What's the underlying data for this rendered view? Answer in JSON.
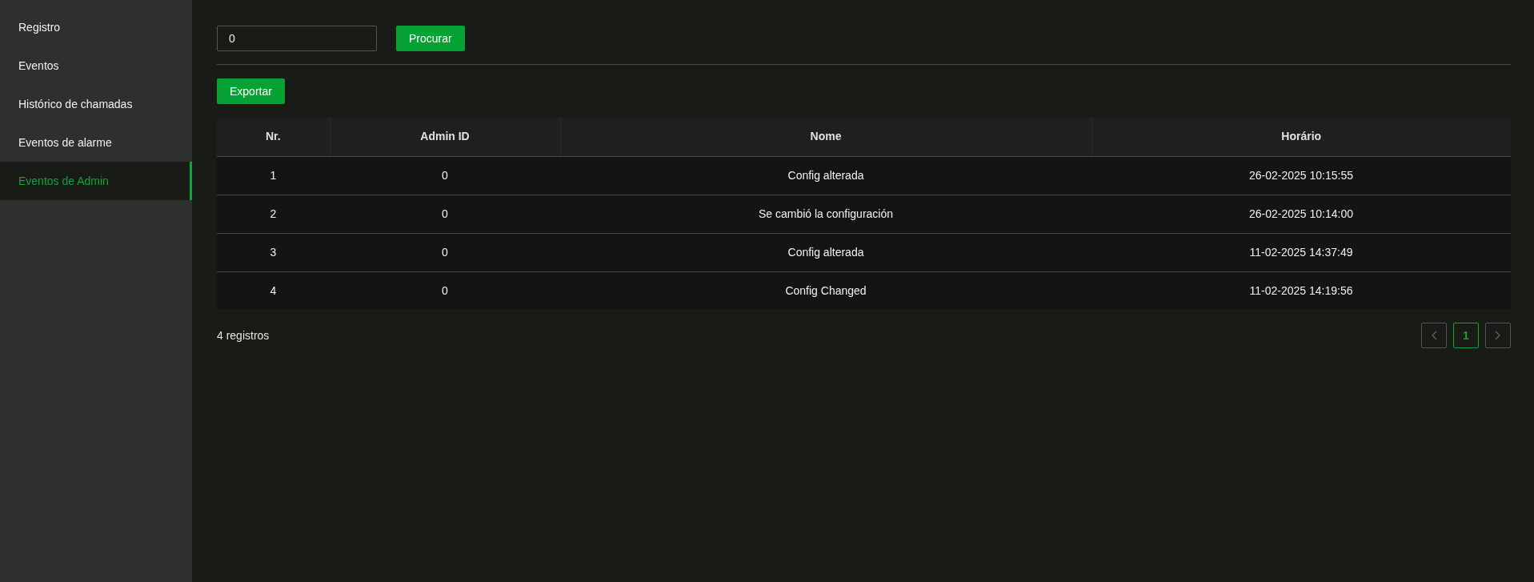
{
  "sidebar": {
    "items": [
      {
        "label": "Registro",
        "selected": false
      },
      {
        "label": "Eventos",
        "selected": false
      },
      {
        "label": "Histórico de chamadas",
        "selected": false
      },
      {
        "label": "Eventos de alarme",
        "selected": false
      },
      {
        "label": "Eventos de Admin",
        "selected": true
      }
    ]
  },
  "search": {
    "value": "0",
    "button": "Procurar"
  },
  "export_button": "Exportar",
  "table": {
    "columns": [
      "Nr.",
      "Admin ID",
      "Nome",
      "Horário"
    ],
    "rows": [
      [
        "1",
        "0",
        "Config alterada",
        "26-02-2025 10:15:55"
      ],
      [
        "2",
        "0",
        "Se cambió la configuración",
        "26-02-2025 10:14:00"
      ],
      [
        "3",
        "0",
        "Config alterada",
        "11-02-2025 14:37:49"
      ],
      [
        "4",
        "0",
        "Config Changed",
        "11-02-2025 14:19:56"
      ]
    ]
  },
  "footer": {
    "count": "4 registros",
    "pagination": {
      "prev_disabled": true,
      "next_disabled": true,
      "pages": [
        {
          "label": "1",
          "selected": true
        }
      ]
    }
  }
}
